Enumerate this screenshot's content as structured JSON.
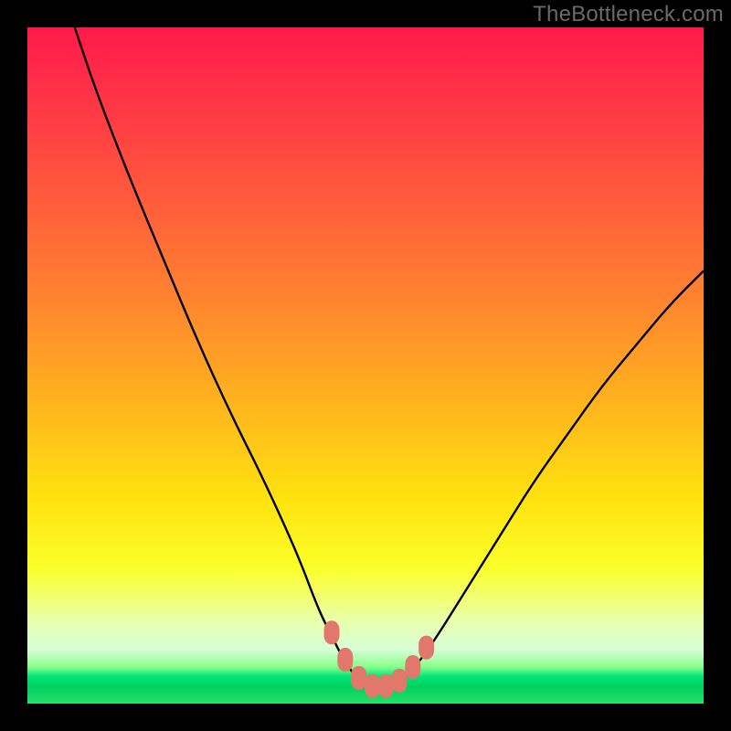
{
  "watermark": "TheBottleneck.com",
  "chart_data": {
    "type": "line",
    "title": "",
    "xlabel": "",
    "ylabel": "",
    "xlim": [
      0,
      100
    ],
    "ylim": [
      0,
      100
    ],
    "series": [
      {
        "name": "bottleneck-curve",
        "x": [
          7,
          10,
          15,
          20,
          25,
          30,
          35,
          40,
          43,
          45,
          47,
          49,
          51,
          53,
          55,
          57,
          60,
          65,
          70,
          75,
          80,
          85,
          90,
          95,
          100
        ],
        "y": [
          100,
          91,
          78,
          66,
          54,
          43,
          33,
          22,
          14,
          10,
          6,
          3.5,
          2.6,
          2.6,
          3.2,
          5,
          9,
          17,
          25,
          33,
          40,
          47,
          53,
          59,
          64
        ]
      }
    ],
    "markers": {
      "name": "highlight-points",
      "x": [
        45,
        47,
        49,
        51,
        53,
        55,
        57,
        59
      ],
      "y": [
        10.5,
        6.5,
        3.8,
        2.6,
        2.6,
        3.4,
        5.4,
        8.3
      ]
    },
    "gradient_stops": [
      {
        "offset": 0.0,
        "color": "#ff1a4b"
      },
      {
        "offset": 0.1,
        "color": "#ff3347"
      },
      {
        "offset": 0.25,
        "color": "#ff5a3c"
      },
      {
        "offset": 0.4,
        "color": "#ff8330"
      },
      {
        "offset": 0.55,
        "color": "#ffb21e"
      },
      {
        "offset": 0.7,
        "color": "#ffe30f"
      },
      {
        "offset": 0.8,
        "color": "#fbff2a"
      },
      {
        "offset": 0.88,
        "color": "#e8ffb0"
      },
      {
        "offset": 0.92,
        "color": "#d6ffd6"
      },
      {
        "offset": 0.945,
        "color": "#8cff8c"
      },
      {
        "offset": 0.96,
        "color": "#00e676"
      },
      {
        "offset": 0.975,
        "color": "#00d060"
      },
      {
        "offset": 1.0,
        "color": "#27e06a"
      }
    ]
  }
}
